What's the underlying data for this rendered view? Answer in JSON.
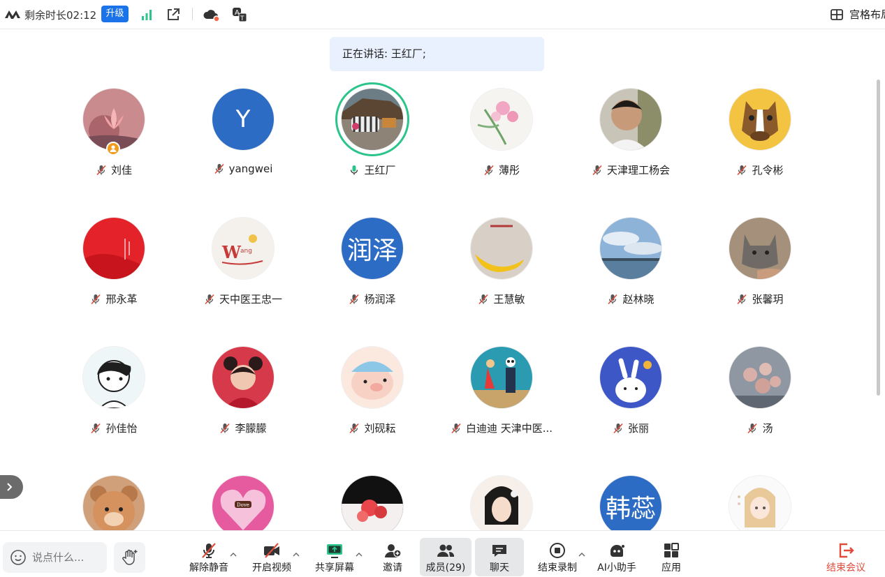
{
  "topbar": {
    "remaining_time": "剩余时长02:12",
    "upgrade_label": "升级",
    "layout_label": "宫格布局"
  },
  "speaking_banner": "正在讲话: 王红厂;",
  "members": [
    {
      "name": "刘佳",
      "avatar": "photo-lotus",
      "muted": true,
      "host": true
    },
    {
      "name": "yangwei",
      "avatar": "initial",
      "initials": "Y",
      "muted": true
    },
    {
      "name": "王红厂",
      "avatar": "photo-zebra",
      "muted": false,
      "speaking": true
    },
    {
      "name": "薄彤",
      "avatar": "photo-flowers",
      "muted": true
    },
    {
      "name": "天津理工杨会",
      "avatar": "photo-child",
      "muted": true
    },
    {
      "name": "孔令彬",
      "avatar": "cartoon-horse",
      "muted": true
    },
    {
      "name": "邢永革",
      "avatar": "photo-red",
      "muted": true
    },
    {
      "name": "天中医王忠一",
      "avatar": "logo-wang",
      "muted": true
    },
    {
      "name": "杨润泽",
      "avatar": "initial",
      "initials": "润泽",
      "muted": true
    },
    {
      "name": "王慧敏",
      "avatar": "photo-banana",
      "muted": true
    },
    {
      "name": "赵林晓",
      "avatar": "photo-sky",
      "muted": true
    },
    {
      "name": "张馨玥",
      "avatar": "photo-cat",
      "muted": true
    },
    {
      "name": "孙佳怡",
      "avatar": "cartoon-boy",
      "muted": true
    },
    {
      "name": "李朦朦",
      "avatar": "cartoon-girl-red",
      "muted": true
    },
    {
      "name": "刘砚耘",
      "avatar": "cartoon-pig",
      "muted": true
    },
    {
      "name": "白迪迪  天津中医...",
      "avatar": "photo-couple",
      "muted": true
    },
    {
      "name": "张丽",
      "avatar": "cartoon-rabbit",
      "muted": true
    },
    {
      "name": "汤",
      "avatar": "photo-flowers-gray",
      "muted": true
    },
    {
      "name": "",
      "avatar": "cartoon-bear",
      "muted": true
    },
    {
      "name": "",
      "avatar": "dove-heart",
      "muted": true
    },
    {
      "name": "",
      "avatar": "photo-red-flowers",
      "muted": true
    },
    {
      "name": "",
      "avatar": "illustration-woman",
      "muted": true
    },
    {
      "name": "",
      "avatar": "initial",
      "initials": "韩蕊",
      "muted": true
    },
    {
      "name": "",
      "avatar": "anime-girl",
      "muted": true
    }
  ],
  "chat": {
    "placeholder": "说点什么..."
  },
  "toolbar": {
    "unmute": "解除静音",
    "start_video": "开启视频",
    "share_screen": "共享屏幕",
    "invite": "邀请",
    "members": "成员(29)",
    "chat": "聊天",
    "end_recording": "结束录制",
    "ai_assistant": "AI小助手",
    "apps": "应用",
    "end_meeting": "结束会议"
  },
  "colors": {
    "accent_blue": "#1a73e8",
    "initials_bg": "#2d6cc4",
    "speaking_green": "#2bc48a",
    "muted_red": "#e04b3a",
    "end_red": "#e04b3a"
  }
}
